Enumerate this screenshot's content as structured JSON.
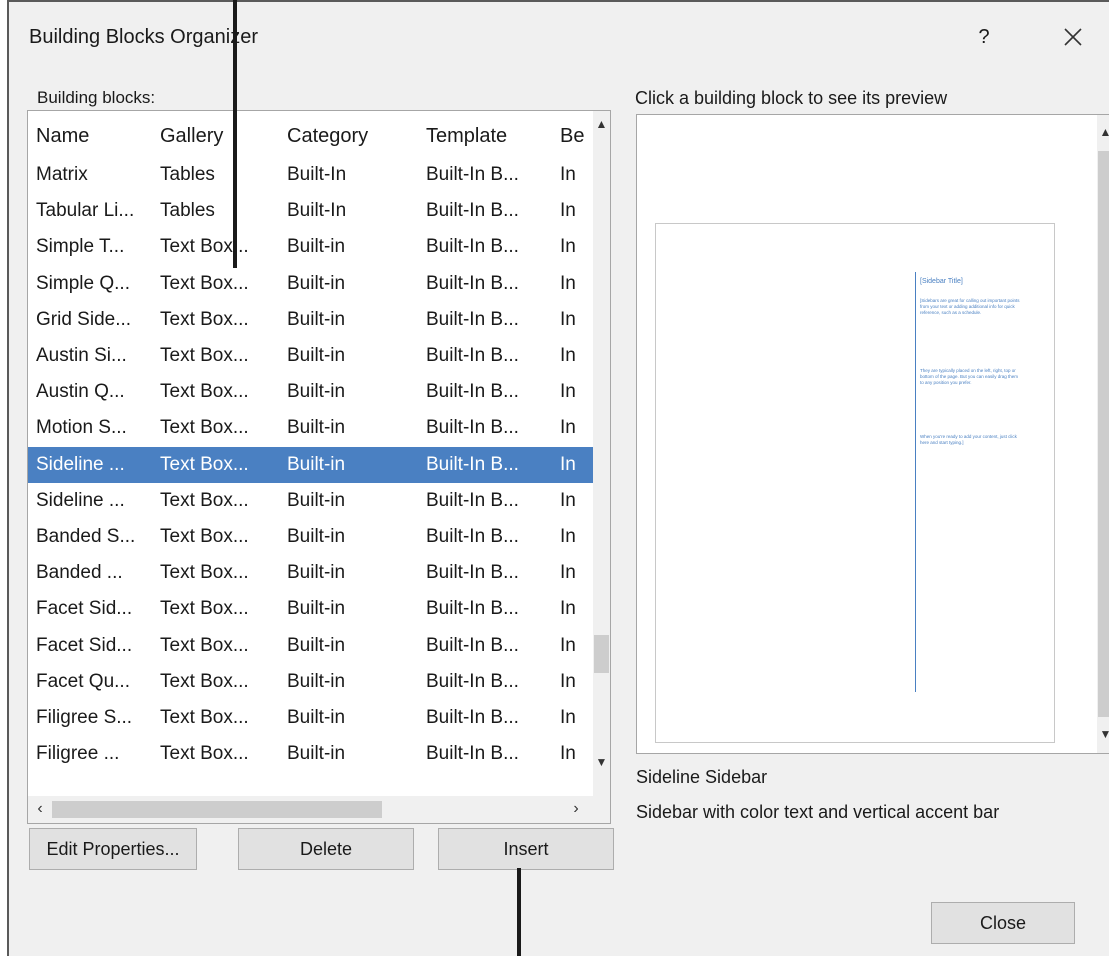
{
  "dialog": {
    "title": "Building Blocks Organizer",
    "help_label": "?"
  },
  "list": {
    "label": "Building blocks:",
    "columns": [
      "Name",
      "Gallery",
      "Category",
      "Template",
      "Be"
    ],
    "rows": [
      [
        "Matrix",
        "Tables",
        "Built-In",
        "Built-In B...",
        "In"
      ],
      [
        "Tabular Li...",
        "Tables",
        "Built-In",
        "Built-In B...",
        "In"
      ],
      [
        " Simple T...",
        "Text Box...",
        "Built-in",
        "Built-In B...",
        "In"
      ],
      [
        "Simple Q...",
        "Text Box...",
        "Built-in",
        "Built-In B...",
        "In"
      ],
      [
        "Grid Side...",
        "Text Box...",
        "Built-in",
        "Built-In B...",
        "In"
      ],
      [
        "Austin Si...",
        "Text Box...",
        "Built-in",
        "Built-In B...",
        "In"
      ],
      [
        "Austin Q...",
        "Text Box...",
        "Built-in",
        "Built-In B...",
        "In"
      ],
      [
        "Motion S...",
        "Text Box...",
        "Built-in",
        "Built-In B...",
        "In"
      ],
      [
        "Sideline ...",
        "Text Box...",
        "Built-in",
        "Built-In B...",
        "In"
      ],
      [
        "Sideline ...",
        "Text Box...",
        "Built-in",
        "Built-In B...",
        "In"
      ],
      [
        "Banded S...",
        "Text Box...",
        "Built-in",
        "Built-In B...",
        "In"
      ],
      [
        "Banded ...",
        "Text Box...",
        "Built-in",
        "Built-In B...",
        "In"
      ],
      [
        "Facet Sid...",
        "Text Box...",
        "Built-in",
        "Built-In B...",
        "In"
      ],
      [
        "Facet Sid...",
        "Text Box...",
        "Built-in",
        "Built-In B...",
        "In"
      ],
      [
        "Facet Qu...",
        "Text Box...",
        "Built-in",
        "Built-In B...",
        "In"
      ],
      [
        "Filigree S...",
        "Text Box...",
        "Built-in",
        "Built-In B...",
        "In"
      ],
      [
        "Filigree ...",
        "Text Box...",
        "Built-in",
        "Built-In B...",
        "In"
      ]
    ],
    "selected_index": 8,
    "selection_color": "#4a80c2"
  },
  "buttons": {
    "edit_properties": "Edit Properties...",
    "delete": "Delete",
    "insert": "Insert",
    "close": "Close"
  },
  "preview": {
    "label": "Click a building block to see its preview",
    "sidebar_title": "[Sidebar Title]",
    "sidebar_paragraphs": [
      "[Sidebars are great for calling out important points from your text or adding additional info for quick reference, such as a schedule.",
      "They are typically placed on the left, right, top or bottom of the page. But you can easily drag them to any position you prefer.",
      "When you're ready to add your content, just click here and start typing.]"
    ],
    "accent_color": "#4a80c2"
  },
  "selected_block": {
    "name": "Sideline Sidebar",
    "description": "Sidebar with color text and vertical accent bar"
  }
}
